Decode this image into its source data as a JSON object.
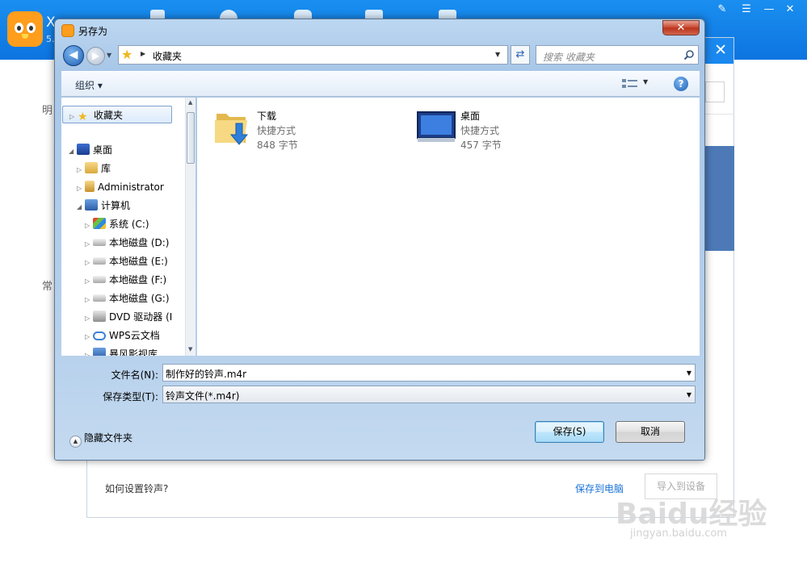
{
  "app": {
    "name": "X",
    "version": "5.",
    "left_labels": [
      "明",
      "常"
    ]
  },
  "bg_modal": {
    "close": "✕",
    "howto": "如何设置铃声?",
    "save_to_pc": "保存到电脑",
    "import": "导入到设备"
  },
  "watermark": {
    "logo": "Baidu经验",
    "url": "jingyan.baidu.com"
  },
  "dialog": {
    "title": "另存为",
    "close": "✕",
    "address": {
      "current": "收藏夹"
    },
    "search": {
      "placeholder": "搜索 收藏夹"
    },
    "toolbar": {
      "organize": "组织 ▾",
      "help": "?"
    },
    "nav_tree": [
      {
        "label": "收藏夹",
        "icon": "star-icon"
      },
      {
        "label": "桌面",
        "icon": "desktop-icon"
      },
      {
        "label": "库",
        "icon": "library-icon"
      },
      {
        "label": "Administrator",
        "icon": "user-folder-icon"
      },
      {
        "label": "计算机",
        "icon": "computer-icon"
      },
      {
        "label": "系统 (C:)",
        "icon": "system-drive-icon"
      },
      {
        "label": "本地磁盘 (D:)",
        "icon": "drive-icon"
      },
      {
        "label": "本地磁盘 (E:)",
        "icon": "drive-icon"
      },
      {
        "label": "本地磁盘 (F:)",
        "icon": "drive-icon"
      },
      {
        "label": "本地磁盘 (G:)",
        "icon": "drive-icon"
      },
      {
        "label": "DVD 驱动器 (I",
        "icon": "dvd-drive-icon"
      },
      {
        "label": "WPS云文档",
        "icon": "cloud-icon"
      },
      {
        "label": "暴风影视库",
        "icon": "media-library-icon"
      }
    ],
    "files": [
      {
        "name": "下载",
        "type": "快捷方式",
        "size": "848 字节",
        "icon": "download-folder-icon"
      },
      {
        "name": "桌面",
        "type": "快捷方式",
        "size": "457 字节",
        "icon": "desktop-shortcut-icon"
      }
    ],
    "filename": {
      "label": "文件名(N):",
      "value": "制作好的铃声.m4r"
    },
    "filetype": {
      "label": "保存类型(T):",
      "value": "铃声文件(*.m4r)"
    },
    "hide_folders": "隐藏文件夹",
    "save_button": "保存(S)",
    "cancel_button": "取消"
  },
  "colors": {
    "app_blue": "#1a8ff0",
    "dialog_frame": "#a9c7e8",
    "close_red": "#c7432b"
  }
}
